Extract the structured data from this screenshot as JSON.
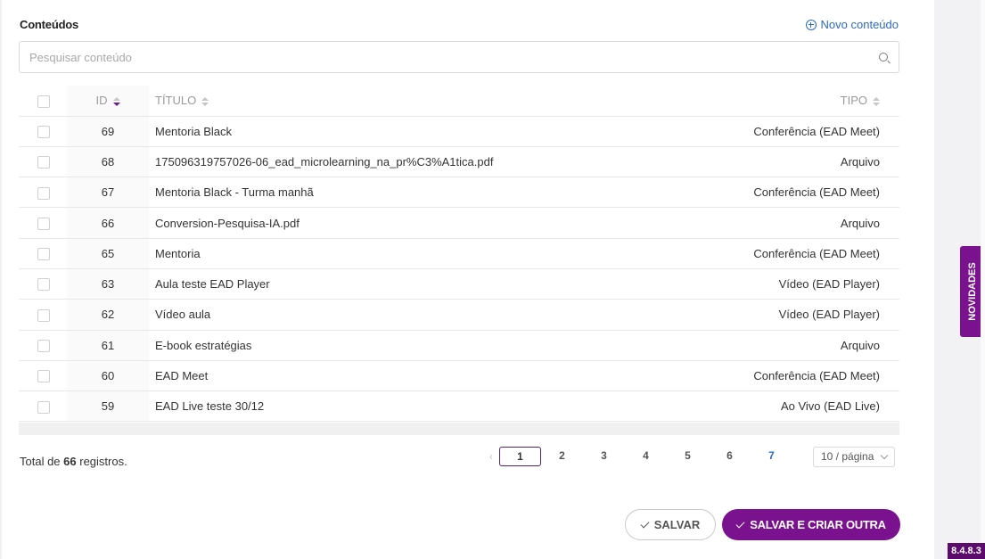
{
  "header": {
    "title": "Conteúdos",
    "new_label": "Novo conteúdo"
  },
  "search": {
    "placeholder": "Pesquisar conteúdo"
  },
  "table": {
    "columns": {
      "id": "ID",
      "title": "TÍTULO",
      "type": "TIPO"
    },
    "rows": [
      {
        "id": "69",
        "title": "Mentoria Black",
        "type": "Conferência (EAD Meet)"
      },
      {
        "id": "68",
        "title": "175096319757026-06_ead_microlearning_na_pr%C3%A1tica.pdf",
        "type": "Arquivo"
      },
      {
        "id": "67",
        "title": "Mentoria Black - Turma manhã",
        "type": "Conferência (EAD Meet)"
      },
      {
        "id": "66",
        "title": "Conversion-Pesquisa-IA.pdf",
        "type": "Arquivo"
      },
      {
        "id": "65",
        "title": "Mentoria",
        "type": "Conferência (EAD Meet)"
      },
      {
        "id": "63",
        "title": "Aula teste EAD Player",
        "type": "Vídeo (EAD Player)"
      },
      {
        "id": "62",
        "title": "Vídeo aula",
        "type": "Vídeo (EAD Player)"
      },
      {
        "id": "61",
        "title": "E-book estratégias",
        "type": "Arquivo"
      },
      {
        "id": "60",
        "title": "EAD Meet",
        "type": "Conferência (EAD Meet)"
      },
      {
        "id": "59",
        "title": "EAD Live teste 30/12",
        "type": "Ao Vivo (EAD Live)"
      }
    ]
  },
  "footer": {
    "total_prefix": "Total de ",
    "total_count": "66",
    "total_suffix": " registros.",
    "pages": [
      "1",
      "2",
      "3",
      "4",
      "5",
      "6",
      "7"
    ],
    "current_page": "1",
    "per_page": "10 / página"
  },
  "actions": {
    "save": "SALVAR",
    "save_create": "SALVAR E CRIAR OUTRA"
  },
  "side": {
    "novidades": "NOVIDADES",
    "version": "8.4.8.3"
  },
  "colors": {
    "accent": "#7a118e",
    "link": "#2d6bc0"
  }
}
